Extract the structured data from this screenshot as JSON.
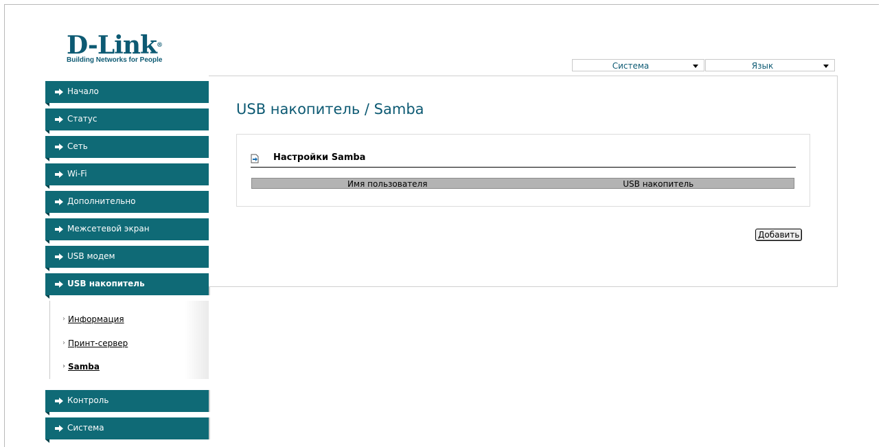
{
  "brand": {
    "name": "D-Link",
    "registered": "®",
    "tagline": "Building Networks for People"
  },
  "top_selects": {
    "system": "Система",
    "language": "Язык"
  },
  "sidebar": {
    "items": [
      {
        "label": "Начало"
      },
      {
        "label": "Статус"
      },
      {
        "label": "Сеть"
      },
      {
        "label": "Wi-Fi"
      },
      {
        "label": "Дополнительно"
      },
      {
        "label": "Межсетевой экран"
      },
      {
        "label": "USB модем"
      },
      {
        "label": "USB накопитель"
      }
    ],
    "submenu": [
      {
        "label": "Информация"
      },
      {
        "label": "Принт-сервер"
      },
      {
        "label": "Samba"
      }
    ],
    "bottom_items": [
      {
        "label": "Контроль"
      },
      {
        "label": "Система"
      }
    ]
  },
  "main": {
    "title": "USB накопитель / Samba",
    "panel": {
      "title": "Настройки Samba",
      "columns": [
        "Имя пользователя",
        "USB накопитель"
      ]
    },
    "add_button": "Добавить"
  },
  "colors": {
    "accent": "#0f6a76",
    "title": "#0d5a73"
  },
  "icons": {
    "nav": "arrow-right-icon",
    "panel": "document-icon"
  }
}
